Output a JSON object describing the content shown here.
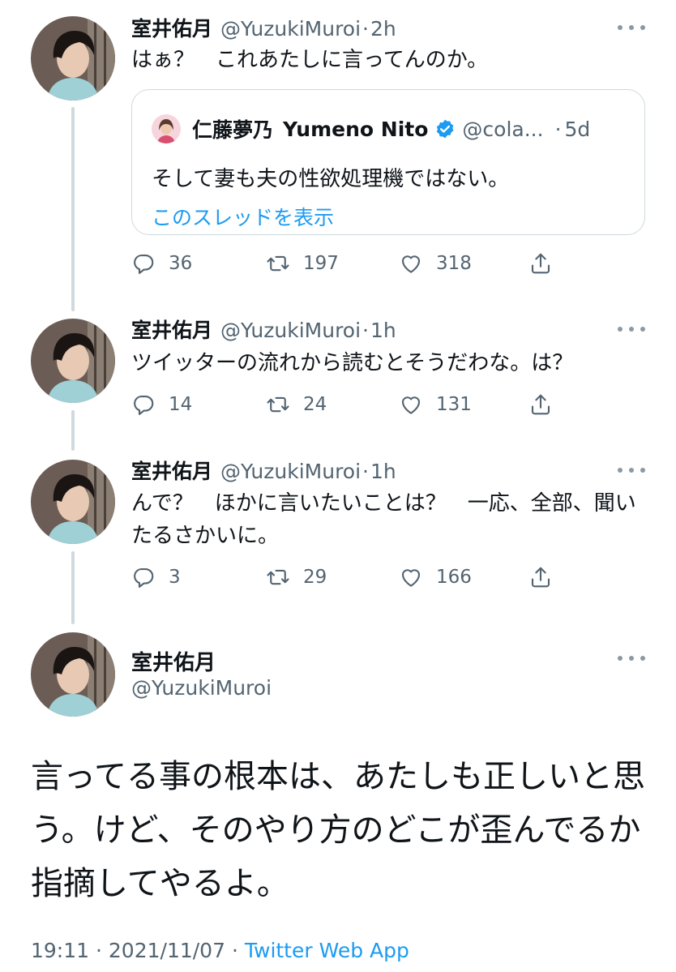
{
  "tweets": [
    {
      "name": "室井佑月",
      "handle": "@YuzukiMuroi",
      "separator": "·",
      "time": "2h",
      "text": "はぁ？　これあたしに言ってんのか。",
      "quote": {
        "name": "仁藤夢乃",
        "display_name": "Yumeno Nito",
        "handle": "@cola...",
        "separator": "·",
        "time": "5d",
        "text": "そして妻も夫の性欲処理機ではない。",
        "link": "このスレッドを表示"
      },
      "replies": "36",
      "retweets": "197",
      "likes": "318"
    },
    {
      "name": "室井佑月",
      "handle": "@YuzukiMuroi",
      "separator": "·",
      "time": "1h",
      "text": "ツイッターの流れから読むとそうだわな。は？",
      "replies": "14",
      "retweets": "24",
      "likes": "131"
    },
    {
      "name": "室井佑月",
      "handle": "@YuzukiMuroi",
      "separator": "·",
      "time": "1h",
      "text": "んで？　ほかに言いたいことは？　一応、全部、聞いたるさかいに。",
      "replies": "3",
      "retweets": "29",
      "likes": "166"
    }
  ],
  "main_tweet": {
    "name": "室井佑月",
    "handle": "@YuzukiMuroi",
    "text": "言ってる事の根本は、あたしも正しいと思う。けど、そのやり方のどこが歪んでるか指摘してやるよ。",
    "time": "19:11",
    "date": "2021/11/07",
    "separator": "·",
    "app": "Twitter Web App"
  },
  "colors": {
    "text_primary": "#0f1419",
    "text_secondary": "#536471",
    "link": "#1d9bf0",
    "border": "#cfd9de",
    "verified": "#1d9bf0"
  },
  "icons": [
    "more-icon",
    "reply-icon",
    "retweet-icon",
    "like-icon",
    "share-icon",
    "verified-badge-icon"
  ]
}
